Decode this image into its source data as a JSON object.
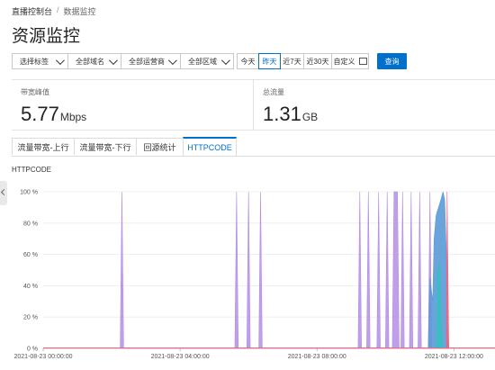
{
  "breadcrumb": {
    "root": "直播控制台",
    "separator": "/",
    "current": "数据监控"
  },
  "page_title": "资源监控",
  "filters": {
    "selects": [
      "选择标签",
      "全部域名",
      "全部运营商",
      "全部区域"
    ],
    "date_options": [
      "今天",
      "昨天",
      "近7天",
      "近30天",
      "自定义"
    ],
    "active_date": "昨天",
    "query_label": "查询"
  },
  "stats": {
    "bandwidth": {
      "label": "带宽峰值",
      "value": "5.77",
      "unit": "Mbps"
    },
    "traffic": {
      "label": "总流量",
      "value": "1.31",
      "unit": "GB"
    }
  },
  "tabs": [
    "流量带宽-上行",
    "流量带宽-下行",
    "回源统计",
    "HTTPCODE"
  ],
  "active_tab": "HTTPCODE",
  "chart_data": {
    "type": "area",
    "title": "HTTPCODE",
    "y_ticks": [
      "100 %",
      "80 %",
      "60 %",
      "40 %",
      "20 %",
      "0 %"
    ],
    "x_ticks": [
      "2021-08-23 00:00:00",
      "2021-08-23 04:00:00",
      "2021-08-23 08:00:00",
      "2021-08-23 12:00:00"
    ],
    "ylim": [
      0,
      100
    ],
    "xlim": [
      0,
      13.2
    ],
    "series": [
      {
        "color": "#b48ee6",
        "points": [
          [
            2.25,
            0
          ],
          [
            2.3,
            100
          ],
          [
            2.35,
            0
          ],
          [
            5.6,
            0
          ],
          [
            5.65,
            100
          ],
          [
            5.7,
            0
          ],
          [
            5.95,
            0
          ],
          [
            6.0,
            100
          ],
          [
            6.05,
            0
          ],
          [
            6.3,
            0
          ],
          [
            6.35,
            100
          ],
          [
            6.4,
            0
          ],
          [
            9.2,
            0
          ],
          [
            9.25,
            100
          ],
          [
            9.3,
            0
          ],
          [
            9.45,
            0
          ],
          [
            9.5,
            100
          ],
          [
            9.55,
            0
          ],
          [
            9.75,
            0
          ],
          [
            9.8,
            100
          ],
          [
            9.85,
            0
          ],
          [
            10.0,
            0
          ],
          [
            10.05,
            100
          ],
          [
            10.1,
            0
          ],
          [
            10.2,
            0
          ],
          [
            10.25,
            100
          ],
          [
            10.35,
            100
          ],
          [
            10.4,
            0
          ],
          [
            10.45,
            0
          ],
          [
            10.5,
            100
          ],
          [
            10.55,
            0
          ],
          [
            10.7,
            0
          ],
          [
            10.75,
            100
          ],
          [
            10.8,
            0
          ],
          [
            10.95,
            0
          ],
          [
            11.0,
            100
          ],
          [
            11.05,
            0
          ],
          [
            11.25,
            0
          ],
          [
            11.3,
            100
          ],
          [
            11.35,
            0
          ]
        ]
      },
      {
        "color": "#5b9ad6",
        "points": [
          [
            11.25,
            0
          ],
          [
            11.3,
            45
          ],
          [
            11.38,
            30
          ],
          [
            11.42,
            70
          ],
          [
            11.48,
            85
          ],
          [
            11.55,
            90
          ],
          [
            11.62,
            95
          ],
          [
            11.68,
            100
          ],
          [
            11.73,
            95
          ],
          [
            11.78,
            60
          ],
          [
            11.82,
            15
          ],
          [
            11.85,
            0
          ]
        ]
      },
      {
        "color": "#35c0c0",
        "points": [
          [
            11.5,
            0
          ],
          [
            11.52,
            50
          ],
          [
            11.58,
            55
          ],
          [
            11.62,
            20
          ],
          [
            11.66,
            5
          ],
          [
            11.7,
            0
          ]
        ]
      },
      {
        "color": "#f2637b",
        "points": [
          [
            11.78,
            0
          ],
          [
            11.8,
            100
          ],
          [
            11.85,
            0
          ]
        ]
      }
    ]
  }
}
